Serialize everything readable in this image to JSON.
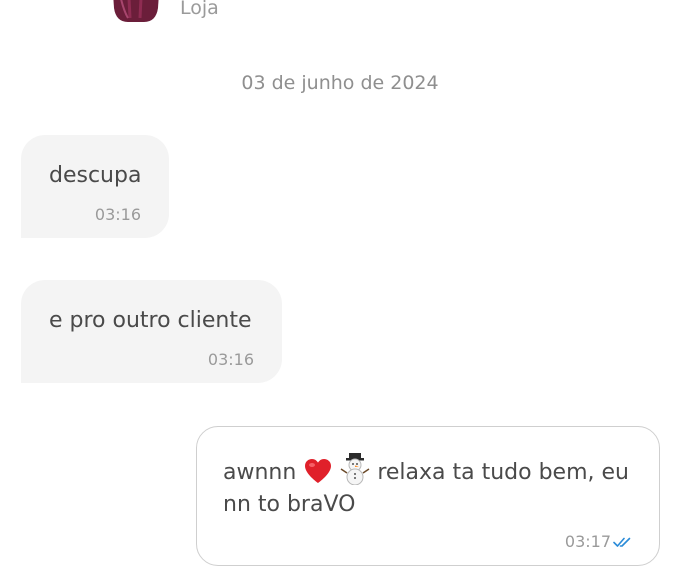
{
  "header": {
    "store_label": "Loja",
    "avatar_icon": "store-avatar-icon"
  },
  "chat": {
    "date_separator": "03 de junho de 2024",
    "messages": [
      {
        "direction": "incoming",
        "text": "descupa",
        "time": "03:16"
      },
      {
        "direction": "incoming",
        "text": "e pro outro cliente",
        "time": "03:16"
      },
      {
        "direction": "outgoing",
        "text_part1": "awnnn",
        "emoji_1": "red-heart-icon",
        "emoji_2": "snowman-icon",
        "text_part2": "relaxa ta tudo bem, eu",
        "text_line2": "nn to braVO",
        "time": "03:17",
        "status_icon": "double-check-icon"
      }
    ]
  },
  "colors": {
    "incoming_bubble": "#f4f4f4",
    "outgoing_border": "#cfcfcf",
    "read_check": "#2a8bd8",
    "avatar": "#6b1e3a"
  }
}
